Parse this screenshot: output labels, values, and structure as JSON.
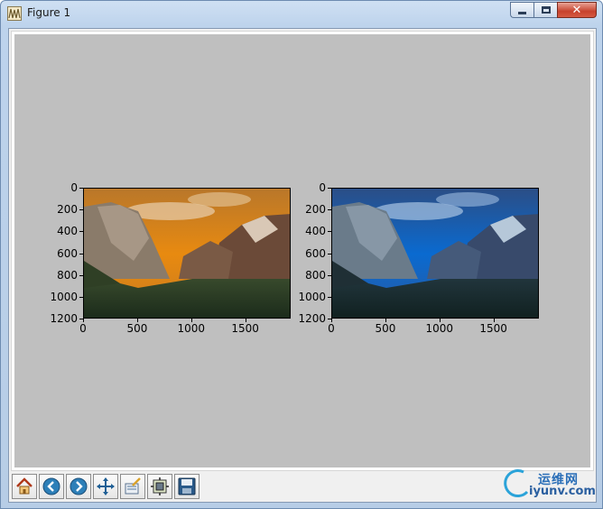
{
  "window": {
    "title": "Figure 1",
    "controls": {
      "minimize": "minimize",
      "maximize": "maximize",
      "close": "close"
    }
  },
  "figure": {
    "background": "#bfbfbf",
    "plots": [
      {
        "name": "image-left",
        "tint": "warm",
        "y_ticks": [
          "0",
          "200",
          "400",
          "600",
          "800",
          "1000",
          "1200"
        ],
        "x_ticks": [
          "0",
          "500",
          "1000",
          "1500"
        ]
      },
      {
        "name": "image-right",
        "tint": "cool",
        "y_ticks": [
          "0",
          "200",
          "400",
          "600",
          "800",
          "1000",
          "1200"
        ],
        "x_ticks": [
          "0",
          "500",
          "1000",
          "1500"
        ]
      }
    ]
  },
  "toolbar": {
    "buttons": [
      "home-icon",
      "back-arrow-icon",
      "forward-arrow-icon",
      "pan-icon",
      "zoom-icon",
      "subplots-icon",
      "save-icon"
    ]
  },
  "watermark": {
    "cn": "运维网",
    "url": "iyunv.com"
  }
}
